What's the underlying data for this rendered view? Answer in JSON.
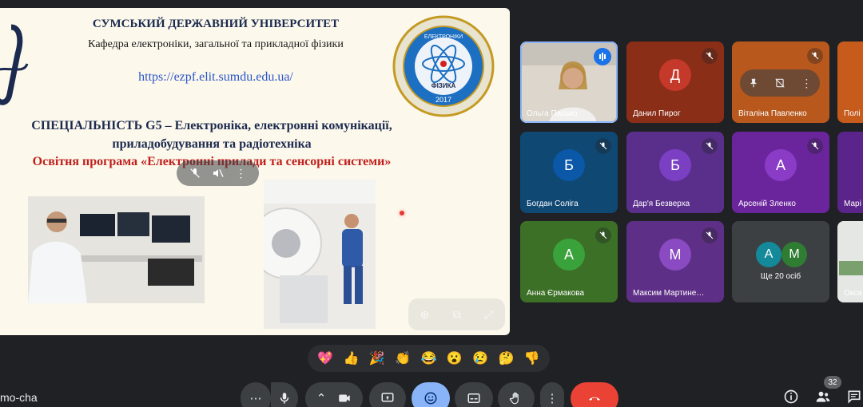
{
  "slide": {
    "university": "СУМСЬКИЙ ДЕРЖАВНИЙ УНІВЕРСИТЕТ",
    "department": "Кафедра електроніки, загальної та прикладної фізики",
    "url": "https://ezpf.elit.sumdu.edu.ua/",
    "specialty_line1": "СПЕЦІАЛЬНІСТЬ G5 – Електроніка, електронні комунікації,",
    "specialty_line2": "приладобудування та радіотехніка",
    "program": "Освітня програма «Електронні прилади та сенсорні системи»",
    "seal_top_text": "ЕЛЕКТРОНІКИ",
    "seal_center_text": "ФІЗИКА",
    "seal_year": "2017"
  },
  "participants": [
    {
      "name": "Ольга Пасько",
      "type": "video",
      "speaking": true
    },
    {
      "name": "Данил Пирог",
      "initial": "Д",
      "color": "#c5392a",
      "bg": "#8a2e18"
    },
    {
      "name": "Віталіна Павленко",
      "initial": "",
      "color": "#d8641f",
      "bg": "#b8581d"
    },
    {
      "name": "Полі",
      "initial": "",
      "color": "#c2571c",
      "bg": "#c65b1c"
    },
    {
      "name": "Богдан Соліга",
      "initial": "Б",
      "color": "#0b57a8",
      "bg": "#104874"
    },
    {
      "name": "Дар'я Безверха",
      "initial": "Б",
      "color": "#7b3fc4",
      "bg": "#5a2f8c"
    },
    {
      "name": "Арсеній Зленко",
      "initial": "А",
      "color": "#8a3cc7",
      "bg": "#6a259c"
    },
    {
      "name": "Марі",
      "initial": "",
      "color": "#6c2c9c",
      "bg": "#5a248a"
    },
    {
      "name": "Анна Єрмакова",
      "initial": "А",
      "color": "#3aa23a",
      "bg": "#3d7027"
    },
    {
      "name": "Максим Мартине…",
      "initial": "М",
      "color": "#8a4ac2",
      "bg": "#5e2f86"
    },
    {
      "name": "Ще 20 осіб",
      "initials": [
        "А",
        "М"
      ],
      "colors": [
        "#14899a",
        "#2e7d32"
      ],
      "bg": "#3c4043"
    },
    {
      "name": "Окса",
      "type": "video"
    }
  ],
  "reactions": [
    "💖",
    "👍",
    "🎉",
    "👏",
    "😂",
    "😮",
    "😢",
    "🤔",
    "👎"
  ],
  "toolbar": {
    "meeting_code": "mo-cha",
    "participants_count": "32"
  }
}
